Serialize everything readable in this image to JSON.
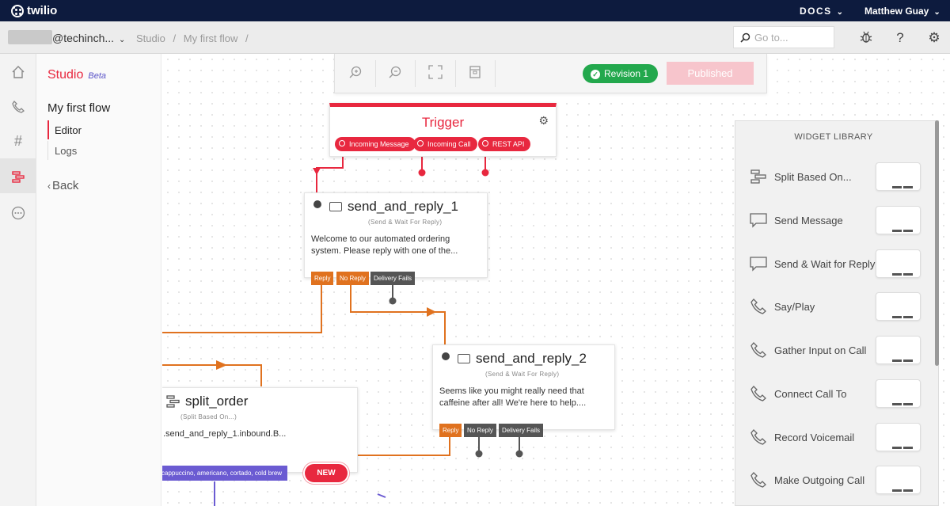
{
  "topbar": {
    "brand": "twilio",
    "docs": "DOCS",
    "user": "Matthew Guay"
  },
  "breadcrumb": {
    "account": "@techinch...",
    "items": [
      "Studio",
      "/",
      "My first flow",
      "/"
    ],
    "goto_placeholder": "Go to..."
  },
  "rail": {
    "items": [
      "home-icon",
      "phone-icon",
      "hash-icon",
      "studio-icon",
      "more-icon"
    ]
  },
  "studio_nav": {
    "title": "Studio",
    "beta": "Beta",
    "flow_name": "My first flow",
    "editor": "Editor",
    "logs": "Logs",
    "back": "Back"
  },
  "toolbar": {
    "revision": "Revision 1",
    "published": "Published"
  },
  "trigger": {
    "title": "Trigger",
    "ports": [
      "Incoming Message",
      "Incoming Call",
      "REST API"
    ]
  },
  "send_and_reply_1": {
    "title": "send_and_reply_1",
    "subtitle": "(Send & Wait For Reply)",
    "body": "Welcome to our automated ordering system. Please reply with one of the...",
    "ports": [
      "Reply",
      "No Reply",
      "Delivery Fails"
    ]
  },
  "send_and_reply_2": {
    "title": "send_and_reply_2",
    "subtitle": "(Send & Wait For Reply)",
    "body": "Seems like you might really need that caffeine after all! We're here to help....",
    "ports": [
      "Reply",
      "No Reply",
      "Delivery Fails"
    ]
  },
  "split_order": {
    "title": "split_order",
    "subtitle": "(Split Based On...)",
    "body": ".send_and_reply_1.inbound.B...",
    "condition": "cappuccino, americano, cortado, cold brew",
    "new_button": "NEW"
  },
  "library": {
    "title": "WIDGET LIBRARY",
    "items": [
      {
        "label": "Split Based On...",
        "icon": "split-icon"
      },
      {
        "label": "Send Message",
        "icon": "message-icon"
      },
      {
        "label": "Send & Wait for Reply",
        "icon": "message-reply-icon"
      },
      {
        "label": "Say/Play",
        "icon": "phone-icon"
      },
      {
        "label": "Gather Input on Call",
        "icon": "phone-icon"
      },
      {
        "label": "Connect Call To",
        "icon": "phone-icon"
      },
      {
        "label": "Record Voicemail",
        "icon": "phone-icon"
      },
      {
        "label": "Make Outgoing Call",
        "icon": "phone-icon"
      }
    ]
  },
  "colors": {
    "brand_red": "#e8283f",
    "navy": "#0d1b3e",
    "orange": "#e0721f",
    "green": "#23a84d",
    "purple": "#6b5bd2"
  }
}
